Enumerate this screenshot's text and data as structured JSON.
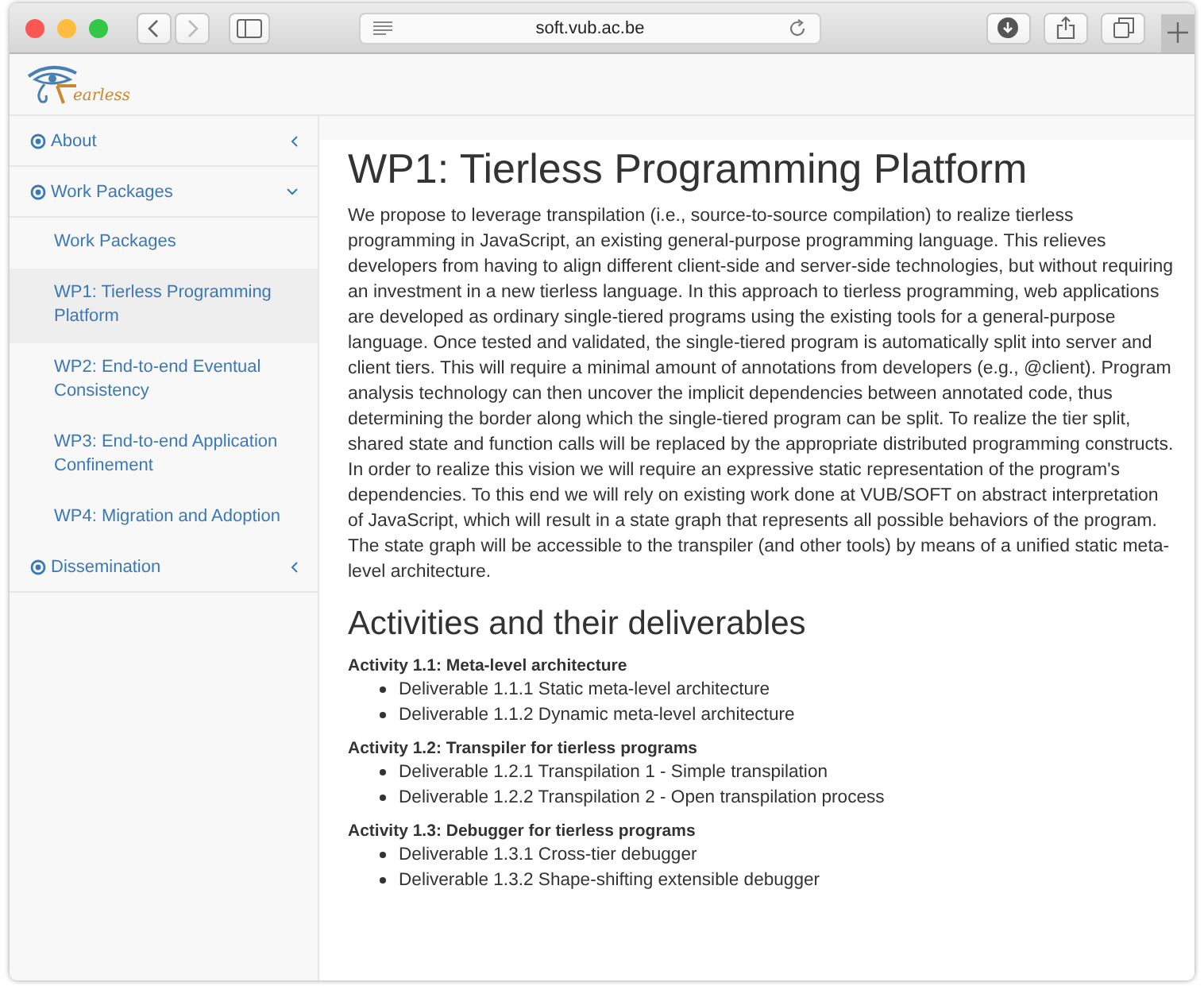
{
  "browser": {
    "url": "soft.vub.ac.be"
  },
  "logo": {
    "text": "earless"
  },
  "sidebar": {
    "items": [
      {
        "label": "About",
        "expanded": false
      },
      {
        "label": "Work Packages",
        "expanded": true,
        "children": [
          {
            "label": "Work Packages",
            "selected": false
          },
          {
            "label": "WP1: Tierless Programming Platform",
            "selected": true
          },
          {
            "label": "WP2: End-to-end Eventual Consistency",
            "selected": false
          },
          {
            "label": "WP3: End-to-end Application Confinement",
            "selected": false
          },
          {
            "label": "WP4: Migration and Adoption",
            "selected": false
          }
        ]
      },
      {
        "label": "Dissemination",
        "expanded": false
      }
    ]
  },
  "content": {
    "title": "WP1: Tierless Programming Platform",
    "paragraph": "We propose to leverage transpilation (i.e., source-to-source compilation) to realize tierless programming in JavaScript, an existing general-purpose programming language. This relieves developers from having to align different client-side and server-side technologies, but without requiring an investment in a new tierless language. In this approach to tierless programming, web applications are developed as ordinary single-tiered programs using the existing tools for a general-purpose language. Once tested and validated, the single-tiered program is automatically split into server and client tiers. This will require a minimal amount of annotations from developers (e.g., @client). Program analysis technology can then uncover the implicit dependencies between annotated code, thus determining the border along which the single-tiered program can be split. To realize the tier split, shared state and function calls will be replaced by the appropriate distributed programming constructs. In order to realize this vision we will require an expressive static representation of the program's dependencies. To this end we will rely on existing work done at VUB/SOFT on abstract interpretation of JavaScript, which will result in a state graph that represents all possible behaviors of the program. The state graph will be accessible to the transpiler (and other tools) by means of a unified static meta-level architecture.",
    "section_title": "Activities and their deliverables",
    "activities": [
      {
        "title": "Activity 1.1: Meta-level architecture",
        "deliverables": [
          "Deliverable 1.1.1 Static meta-level architecture",
          "Deliverable 1.1.2 Dynamic meta-level architecture"
        ]
      },
      {
        "title": "Activity 1.2: Transpiler for tierless programs",
        "deliverables": [
          "Deliverable 1.2.1 Transpilation 1 - Simple transpilation",
          "Deliverable 1.2.2 Transpilation 2 - Open transpilation process"
        ]
      },
      {
        "title": "Activity 1.3: Debugger for tierless programs",
        "deliverables": [
          "Deliverable 1.3.1 Cross-tier debugger",
          "Deliverable 1.3.2 Shape-shifting extensible debugger"
        ]
      }
    ]
  }
}
